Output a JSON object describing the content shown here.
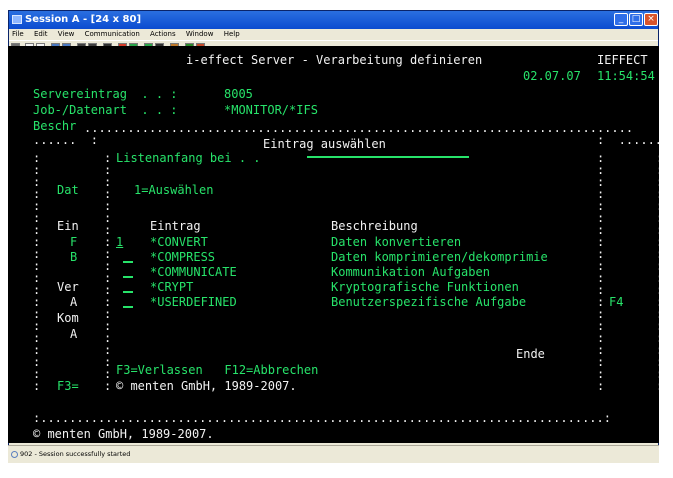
{
  "window": {
    "title": "Session A - [24 x 80]"
  },
  "menu": [
    "File",
    "Edit",
    "View",
    "Communication",
    "Actions",
    "Window",
    "Help"
  ],
  "terminal": {
    "line1": "i-effect Server - Verarbeitung definieren",
    "ieffect": "IEFFECT",
    "date": "02.07.07",
    "time": "11:54:54",
    "serverentry_label": "Servereintrag  . . :",
    "serverentry_value": "8005",
    "jobfile_label": "Job-/Datenart  . . :",
    "jobfile_value": "*MONITOR/*IFS",
    "beschr_label": "Beschr",
    "dialog_title": "Eintrag auswählen",
    "listanfang": "Listenanfang bei . .",
    "dat": "Dat",
    "option_hint": "1=Auswählen",
    "ein": "Ein",
    "head_entry": "Eintrag",
    "head_desc": "Beschreibung",
    "rows": [
      {
        "left": "F",
        "sel": "1",
        "entry": "*CONVERT",
        "desc": "Daten konvertieren"
      },
      {
        "left": "B",
        "sel": "",
        "entry": "*COMPRESS",
        "desc": "Daten komprimieren/dekomprimie"
      },
      {
        "left": "",
        "sel": "",
        "entry": "*COMMUNICATE",
        "desc": "Kommunikation Aufgaben"
      },
      {
        "left": "Ver",
        "sel": "",
        "entry": "*CRYPT",
        "desc": "Kryptografische Funktionen"
      },
      {
        "left": "A",
        "sel": "",
        "entry": "*USERDEFINED",
        "desc": "Benutzerspezifische Aufgabe"
      }
    ],
    "f4": "F4",
    "kom": "Kom",
    "a": "A",
    "ende": "Ende",
    "fkeys": "F3=Verlassen   F12=Abbrechen",
    "f3": "F3=",
    "copyright": "© menten GmbH, 1989-2007.",
    "copyright2": "© menten GmbH, 1989-2007."
  },
  "status": {
    "text": "902 - Session successfully started"
  }
}
